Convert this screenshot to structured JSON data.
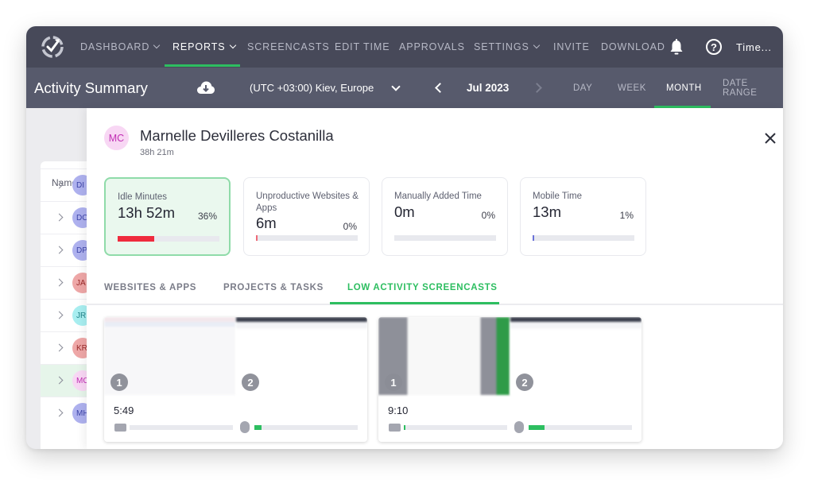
{
  "nav": {
    "items": [
      {
        "label": "DASHBOARD",
        "dropdown": true,
        "active": false
      },
      {
        "label": "REPORTS",
        "dropdown": true,
        "active": true
      },
      {
        "label": "SCREENCASTS",
        "dropdown": false,
        "active": false
      },
      {
        "label": "EDIT TIME",
        "dropdown": false,
        "active": false
      },
      {
        "label": "APPROVALS",
        "dropdown": false,
        "active": false
      },
      {
        "label": "SETTINGS",
        "dropdown": true,
        "active": false
      },
      {
        "label": "INVITE",
        "dropdown": false,
        "active": false
      },
      {
        "label": "DOWNLOAD",
        "dropdown": false,
        "active": false
      }
    ],
    "help_glyph": "?",
    "user_menu": "Time..."
  },
  "subheader": {
    "title": "Activity Summary",
    "timezone": "(UTC +03:00) Kiev, Europe",
    "period": "Jul 2023",
    "range_tabs": [
      {
        "label": "DAY",
        "active": false
      },
      {
        "label": "WEEK",
        "active": false
      },
      {
        "label": "MONTH",
        "active": true
      },
      {
        "label": "DATE RANGE",
        "active": false
      }
    ]
  },
  "list": {
    "header": "Name",
    "rows": [
      {
        "initials": "DI",
        "color": "#aeb1ee",
        "text_color": "#3d44a8",
        "selected": false
      },
      {
        "initials": "DC",
        "color": "#aeb1ee",
        "text_color": "#3d44a8",
        "selected": false
      },
      {
        "initials": "DP",
        "color": "#aeb1ee",
        "text_color": "#3d44a8",
        "selected": false
      },
      {
        "initials": "JA",
        "color": "#eea7a7",
        "text_color": "#9a2b2b",
        "selected": false
      },
      {
        "initials": "JR",
        "color": "#a8eef0",
        "text_color": "#24868c",
        "selected": false
      },
      {
        "initials": "KR",
        "color": "#eea7a7",
        "text_color": "#9a2b2b",
        "selected": false
      },
      {
        "initials": "MC",
        "color": "#f8d7f4",
        "text_color": "#c12fb4",
        "selected": true
      },
      {
        "initials": "MH",
        "color": "#aeb1ee",
        "text_color": "#3d44a8",
        "selected": false
      }
    ]
  },
  "employee": {
    "initials": "MC",
    "name": "Marnelle Devilleres Costanilla",
    "total": "38h 21m"
  },
  "metrics": [
    {
      "label": "Idle Minutes",
      "value": "13h 52m",
      "percent_label": "36%",
      "fraction": 0.36,
      "color": "#ef2b3d",
      "active": true
    },
    {
      "label": "Unproductive Websites & Apps",
      "value": "6m",
      "percent_label": "0%",
      "fraction": 0.004,
      "color": "#ef6a78",
      "active": false
    },
    {
      "label": "Manually Added Time",
      "value": "0m",
      "percent_label": "0%",
      "fraction": 0,
      "color": "#cfd0d8",
      "active": false
    },
    {
      "label": "Mobile Time",
      "value": "13m",
      "percent_label": "1%",
      "fraction": 0.01,
      "color": "#6b72d8",
      "active": false
    }
  ],
  "tabs": [
    {
      "label": "WEBSITES & APPS",
      "active": false
    },
    {
      "label": "PROJECTS & TASKS",
      "active": false
    },
    {
      "label": "LOW ACTIVITY SCREENCASTS",
      "active": true
    }
  ],
  "screencasts": [
    {
      "time": "5:49",
      "keyboard_activity": 0.0,
      "mouse_activity": 0.07,
      "thumb_labels": [
        "1",
        "2"
      ]
    },
    {
      "time": "9:10",
      "keyboard_activity": 0.01,
      "mouse_activity": 0.15,
      "thumb_labels": [
        "1",
        "2"
      ]
    }
  ],
  "colors": {
    "accent": "#2dbe60",
    "nav_bg": "#474959",
    "subbar_bg": "#575a6c"
  }
}
